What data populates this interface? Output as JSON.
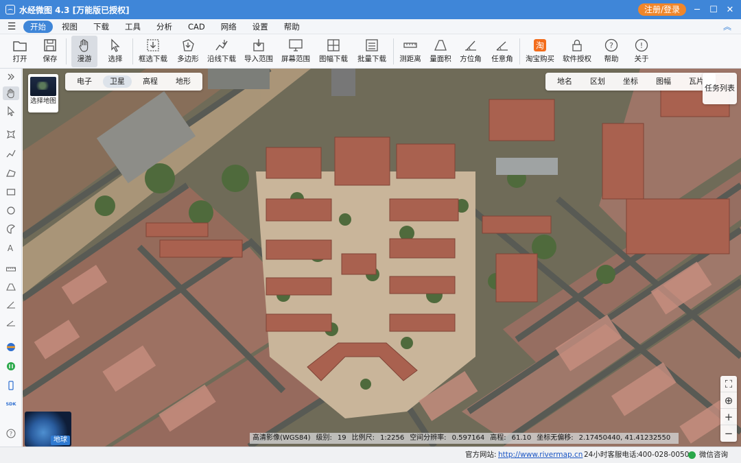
{
  "window": {
    "title": "水经微图 4.3 [万能版已授权]",
    "login_label": "注册/登录"
  },
  "menu": [
    "开始",
    "视图",
    "下载",
    "工具",
    "分析",
    "CAD",
    "网络",
    "设置",
    "帮助"
  ],
  "toolbar": [
    {
      "label": "打开",
      "icon": "folder-icon"
    },
    {
      "label": "保存",
      "icon": "save-icon"
    },
    {
      "label": "漫游",
      "icon": "hand-icon"
    },
    {
      "label": "选择",
      "icon": "cursor-icon"
    },
    {
      "label": "框选下载",
      "icon": "rect-download-icon"
    },
    {
      "label": "多边形",
      "icon": "polygon-download-icon"
    },
    {
      "label": "沿线下载",
      "icon": "line-download-icon"
    },
    {
      "label": "导入范围",
      "icon": "import-range-icon"
    },
    {
      "label": "屏幕范围",
      "icon": "screen-range-icon"
    },
    {
      "label": "图幅下载",
      "icon": "sheet-download-icon"
    },
    {
      "label": "批量下载",
      "icon": "batch-download-icon"
    },
    {
      "label": "测距离",
      "icon": "measure-distance-icon"
    },
    {
      "label": "量面积",
      "icon": "measure-area-icon"
    },
    {
      "label": "方位角",
      "icon": "azimuth-icon"
    },
    {
      "label": "任意角",
      "icon": "angle-icon"
    },
    {
      "label": "淘宝购买",
      "icon": "taobao-icon"
    },
    {
      "label": "软件授权",
      "icon": "lock-icon"
    },
    {
      "label": "帮助",
      "icon": "help-icon"
    },
    {
      "label": "关于",
      "icon": "info-icon"
    }
  ],
  "map": {
    "layer_thumb_label": "选择地图",
    "map_types": [
      "电子",
      "卫星",
      "高程",
      "地形"
    ],
    "active_map_type": "卫星",
    "overlays": [
      "地名",
      "区划",
      "坐标",
      "图幅",
      "瓦片"
    ],
    "task_list": "任务列表",
    "globe_label": "地球",
    "info": {
      "source": "高清影像(WGS84)",
      "level_label": "级别:",
      "level": "19",
      "scale_label": "比例尺:",
      "scale": "1:2256",
      "resolution_label": "空间分辨率:",
      "resolution": "0.597164",
      "elevation_label": "高程:",
      "elevation": "61.10",
      "coord_label": "坐标无偏移:",
      "coord": "2.17450440, 41.41232550"
    }
  },
  "status": {
    "website_label": "官方网站:",
    "website": "http://www.rivermap.cn",
    "phone_label": "24小时客服电话:",
    "phone": "400-028-0050",
    "wechat": "微信咨询"
  }
}
